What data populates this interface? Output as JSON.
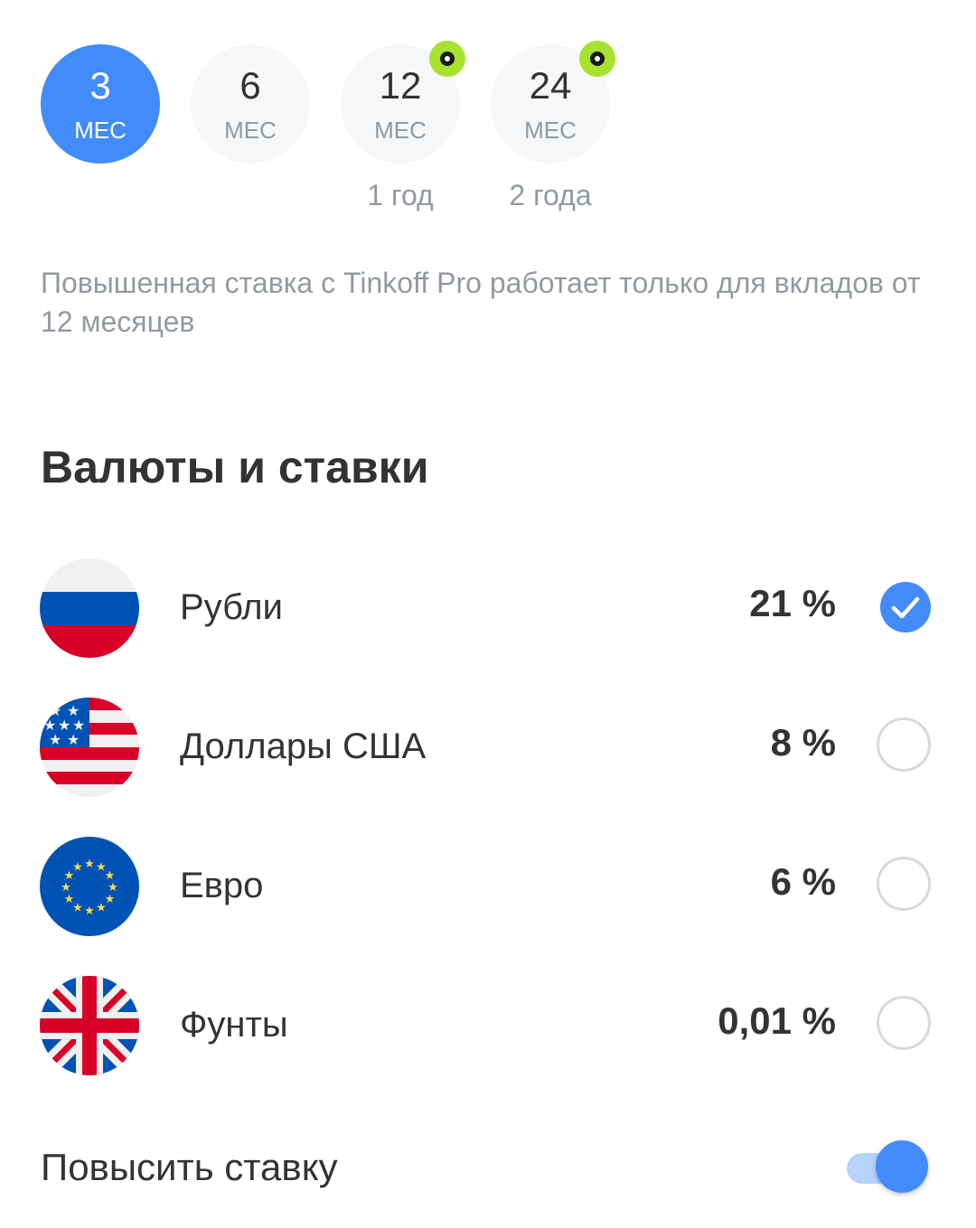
{
  "terms": [
    {
      "number": "3",
      "unit": "МЕС",
      "selected": true
    },
    {
      "number": "6",
      "unit": "МЕС"
    },
    {
      "number": "12",
      "unit": "МЕС",
      "sub": "1 год",
      "pro_badge": true
    },
    {
      "number": "24",
      "unit": "МЕС",
      "sub": "2 года",
      "pro_badge": true
    }
  ],
  "note": "Повышенная ставка с Tinkoff Pro работает только для вкладов от 12 месяцев",
  "section_title": "Валюты и ставки",
  "currencies": [
    {
      "name": "Рубли",
      "rate": "21 %",
      "flag": "russia-flag-icon",
      "selected": true
    },
    {
      "name": "Доллары США",
      "rate": "8 %",
      "flag": "usa-flag-icon",
      "selected": false
    },
    {
      "name": "Евро",
      "rate": "6 %",
      "flag": "eu-flag-icon",
      "selected": false
    },
    {
      "name": "Фунты",
      "rate": "0,01 %",
      "flag": "uk-flag-icon",
      "selected": false
    }
  ],
  "boost": {
    "label": "Повысить ставку",
    "enabled": true
  },
  "colors": {
    "accent": "#428bf9",
    "badge": "#a7e22e",
    "muted": "#9299a2"
  }
}
